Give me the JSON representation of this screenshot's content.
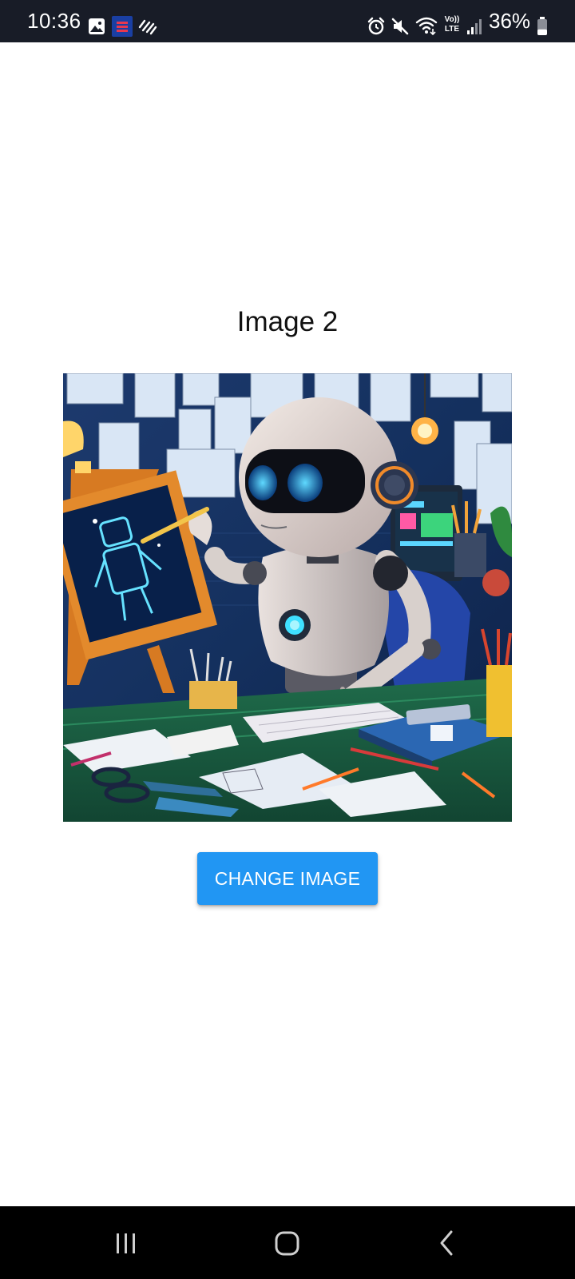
{
  "status_bar": {
    "time": "10:36",
    "battery_percent": "36%",
    "battery_level": 0.36,
    "network_label_top": "Vo))",
    "network_label_bottom": "LTE",
    "left_icons": [
      "gallery-icon",
      "app-notification-icon",
      "sync-stripes-icon"
    ],
    "right_icons": [
      "alarm-icon",
      "mute-icon",
      "wifi-icon",
      "volte-icon",
      "signal-icon",
      "battery-icon"
    ]
  },
  "main": {
    "title": "Image 2",
    "button_label": "CHANGE IMAGE"
  },
  "nav_bar": {
    "icons": [
      "recent-apps-icon",
      "home-icon",
      "back-icon"
    ]
  },
  "colors": {
    "status_bar_bg": "#181c27",
    "button_bg": "#2196f3",
    "button_text": "#ffffff",
    "nav_bar_bg": "#000000",
    "page_bg": "#ffffff"
  }
}
